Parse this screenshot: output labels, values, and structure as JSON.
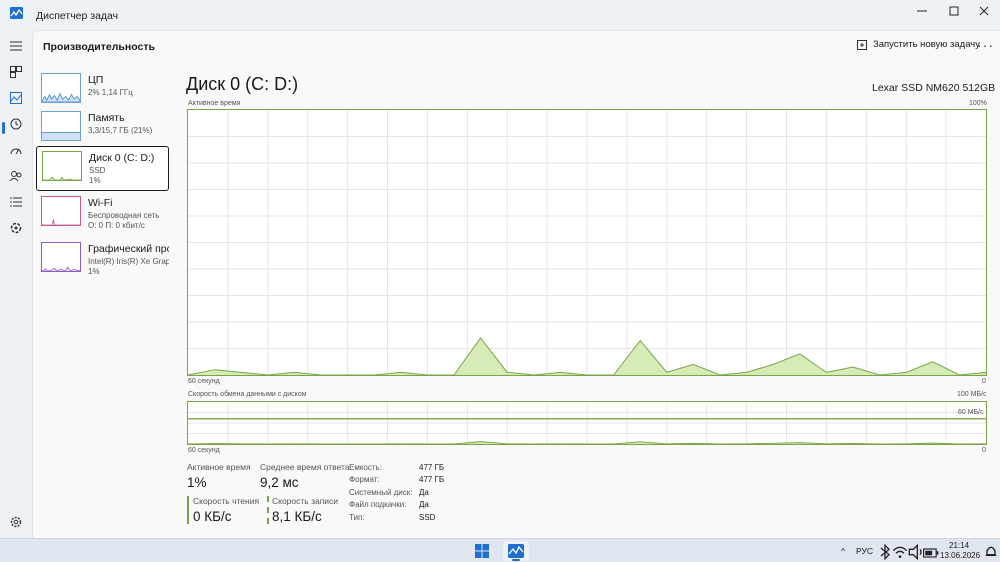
{
  "window": {
    "title": "Диспетчер задач",
    "minimize": "—",
    "maximize": "▢",
    "close": "✕"
  },
  "rail": {
    "icons": [
      "menu-icon",
      "processes-icon",
      "performance-icon",
      "history-icon",
      "startup-icon",
      "users-icon",
      "details-icon",
      "services-icon",
      "settings-icon"
    ]
  },
  "header": {
    "page_title": "Производительность",
    "run_task_label": "Запустить новую задачу",
    "more_label": "···"
  },
  "devices": [
    {
      "name": "ЦП",
      "line1": "2% 1,14 ГГц",
      "line2": ""
    },
    {
      "name": "Память",
      "line1": "3,3/15,7 ГБ (21%)",
      "line2": ""
    },
    {
      "name": "Диск 0 (C: D:)",
      "line1": "SSD",
      "line2": "1%"
    },
    {
      "name": "Wi-Fi",
      "line1": "Беспроводная сеть",
      "line2": "О: 0 П: 0 кбит/с"
    },
    {
      "name": "Графический про",
      "line1": "Intel(R) Iris(R) Xe Graph",
      "line2": "1%"
    }
  ],
  "detail": {
    "title": "Диск 0 (C: D:)",
    "model": "Lexar SSD NM620 512GB",
    "graph1": {
      "label": "Активное время",
      "max_label": "100%",
      "x_left": "60 секунд",
      "x_right": "0"
    },
    "graph2": {
      "label": "Скорость обмена данными с диском",
      "max_label": "100 МБ/с",
      "mid_label": "60 МБ/с",
      "x_left": "60 секунд",
      "x_right": "0"
    },
    "stats": {
      "active_time_label": "Активное время",
      "active_time_value": "1%",
      "avg_response_label": "Среднее время ответа",
      "avg_response_value": "9,2 мс",
      "read_label": "Скорость чтения",
      "read_value": "0 КБ/с",
      "write_label": "Скорость записи",
      "write_value": "8,1 КБ/с"
    },
    "props": [
      {
        "key": "Емкость:",
        "value": "477 ГБ"
      },
      {
        "key": "Формат:",
        "value": "477 ГБ"
      },
      {
        "key": "Системный диск:",
        "value": "Да"
      },
      {
        "key": "Файл подкачки:",
        "value": "Да"
      },
      {
        "key": "Тип:",
        "value": "SSD"
      }
    ]
  },
  "chart_data": {
    "type": "area",
    "title": "Активное время",
    "ylim": [
      0,
      100
    ],
    "x": [
      60,
      58,
      56,
      54,
      52,
      50,
      48,
      46,
      44,
      42,
      40,
      38,
      36,
      34,
      32,
      30,
      28,
      26,
      24,
      22,
      20,
      18,
      16,
      14,
      12,
      10,
      8,
      6,
      4,
      2,
      0
    ],
    "values": [
      0,
      2,
      1,
      0,
      1,
      0,
      0,
      0,
      1,
      0,
      0,
      14,
      1,
      0,
      1,
      0,
      0,
      13,
      1,
      4,
      0,
      1,
      4,
      8,
      1,
      3,
      0,
      1,
      5,
      0,
      1
    ]
  },
  "taskbar": {
    "lang": "РУС",
    "time": "21:14",
    "date": "13.06.2026",
    "chevron": "^"
  },
  "colors": {
    "accent": "#1e6fd0",
    "disk_line": "#7aa449",
    "disk_fill": "#d6ebb5"
  }
}
